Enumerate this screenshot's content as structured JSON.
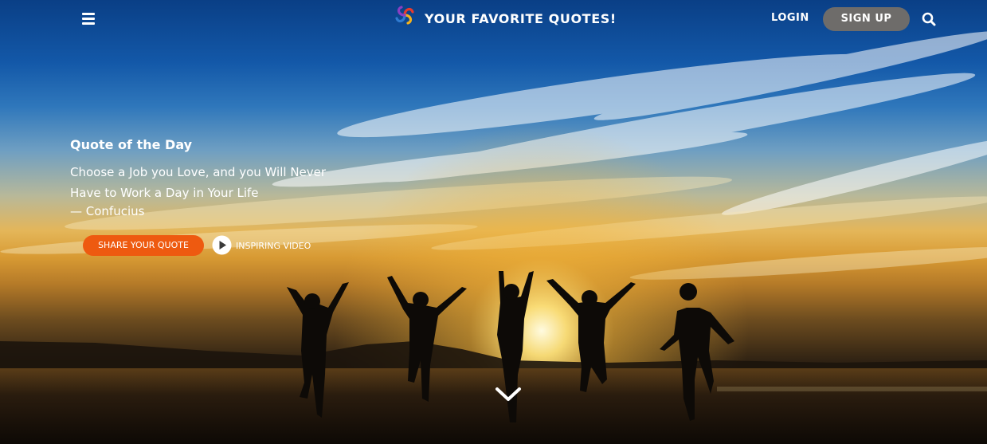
{
  "header": {
    "brand": "YOUR FAVORITE QUOTES!",
    "login_label": "LOGIN",
    "signup_label": "SIGN UP",
    "menu_icon": "hamburger-menu-icon",
    "logo_icon": "pinwheel-logo-icon",
    "search_icon": "search-icon"
  },
  "quote": {
    "heading": "Quote of the Day",
    "text": "Choose a Job you Love, and you Will Never Have to Work a Day in Your Life",
    "author": "— Confucius"
  },
  "actions": {
    "share_label": "SHARE YOUR QUOTE",
    "video_label": "INSPIRING VIDEO",
    "play_icon": "play-circle-icon",
    "scroll_icon": "chevron-down-icon"
  },
  "colors": {
    "accent": "#ee5a10",
    "signup_bg": "#6e6c6a",
    "text": "#ffffff"
  }
}
